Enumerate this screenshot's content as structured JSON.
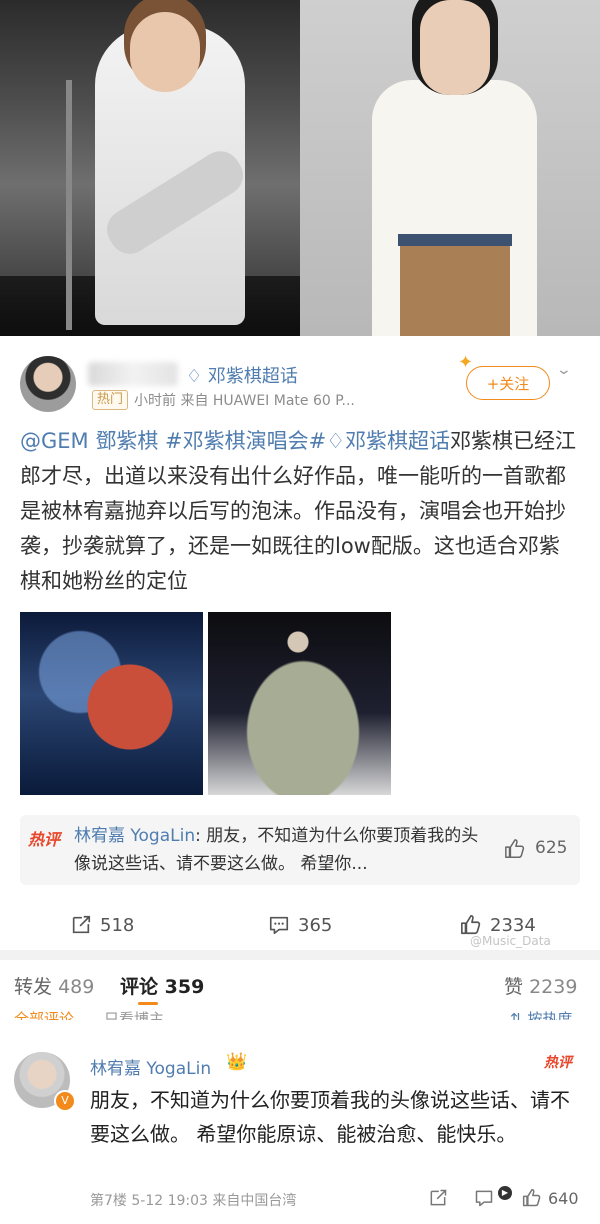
{
  "post": {
    "topic": "邓紫棋超话",
    "hot_badge": "热门",
    "meta": "小时前  来自 HUAWEI Mate 60 P...",
    "follow_label": "+关注",
    "content_links": [
      "@GEM 鄧紫棋",
      "#邓紫棋演唱会#",
      "邓紫棋超话"
    ],
    "content_text": "邓紫棋已经江郎才尽，出道以来没有出什么好作品，唯一能听的一首歌都是被林宥嘉抛弃以后写的泡沫。作品没有，演唱会也开始抄袭，抄袭就算了，还是一如既往的low配版。这也适合邓紫棋和她粉丝的定位"
  },
  "hot_comment": {
    "label": "热评",
    "name": "林宥嘉 YogaLin",
    "text": ": 朋友，不知道为什么你要顶着我的头像说这些话、请不要这么做。 希望你...",
    "likes": "625"
  },
  "actions": {
    "repost": "518",
    "comment": "365",
    "like": "2334"
  },
  "watermark": "@Music_Data",
  "tabs": {
    "repost_label": "转发",
    "repost_count": "489",
    "comment_label": "评论",
    "comment_count": "359",
    "like_label": "赞",
    "like_count": "2239"
  },
  "subfilters": {
    "all": "全部评论",
    "owner": "只看博主",
    "sort": "按热度"
  },
  "comment": {
    "name": "林宥嘉 YogaLin",
    "crown": "👑",
    "hot": "热评",
    "text": "朋友，不知道为什么你要顶着我的头像说这些话、请不要这么做。 希望你能原谅、能被治愈、能快乐。",
    "meta": "第7楼  5-12 19:03  来自中国台湾",
    "likes": "640"
  },
  "colors": {
    "link": "#507daf",
    "accent": "#f28a1c",
    "hot": "#e8472b"
  }
}
